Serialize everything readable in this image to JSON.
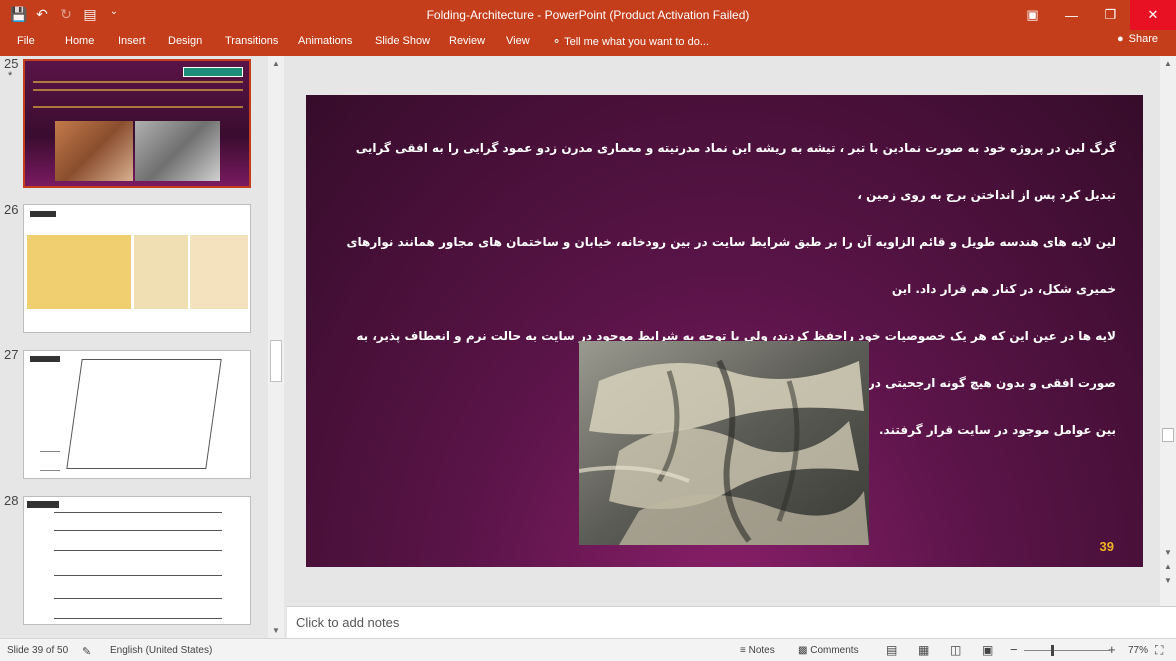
{
  "window": {
    "title": "Folding-Architecture - PowerPoint (Product Activation Failed)",
    "share_label": "Share"
  },
  "quick_access": [
    "save-icon",
    "undo-icon",
    "redo-icon",
    "start-from-beginning-icon",
    "customize-icon"
  ],
  "ribbon": {
    "tabs": [
      "File",
      "Home",
      "Insert",
      "Design",
      "Transitions",
      "Animations",
      "Slide Show",
      "Review",
      "View"
    ],
    "tell_me": "Tell me what you want to do..."
  },
  "thumbnails": [
    {
      "number": "25",
      "star": "*",
      "selected": true,
      "heading": ""
    },
    {
      "number": "26",
      "star": "",
      "selected": false,
      "heading": ""
    },
    {
      "number": "27",
      "star": "",
      "selected": false,
      "heading": ""
    },
    {
      "number": "28",
      "star": "",
      "selected": false,
      "heading": ""
    }
  ],
  "slide": {
    "paragraphs": [
      "گرگ لین در پروژه خود به صورت نمادین با تبر ، تیشه به ریشه این نماد مدرنیته و معماری مدرن زدو عمود گرایی را به افقی گرایی تبدیل کرد پس از انداختن برج به روی زمین ،",
      "لین لایه های هندسه طویل و قائم الزاویه آن را بر طبق شرایط سایت در بین رودخانه، خیابان و ساختمان های مجاور همانند نوارهای خمیری شکل، در کنار هم قرار داد. این",
      "لایه ها در عین این که هر یک خصوصیات خود راحفظ کردند، ولی با توجه به شرایط موجود در سایت به حالت نرم و انعطاف پذیر، به صورت افقی و بدون هیچ گونه ارجحیتی در",
      "بین عوامل موجود در سایت قرار گرفتند."
    ],
    "number": "39"
  },
  "notes_placeholder": "Click to add notes",
  "status": {
    "slide_info": "Slide 39 of 50",
    "language": "English (United States)",
    "notes_label": "Notes",
    "comments_label": "Comments",
    "zoom": "77%"
  }
}
